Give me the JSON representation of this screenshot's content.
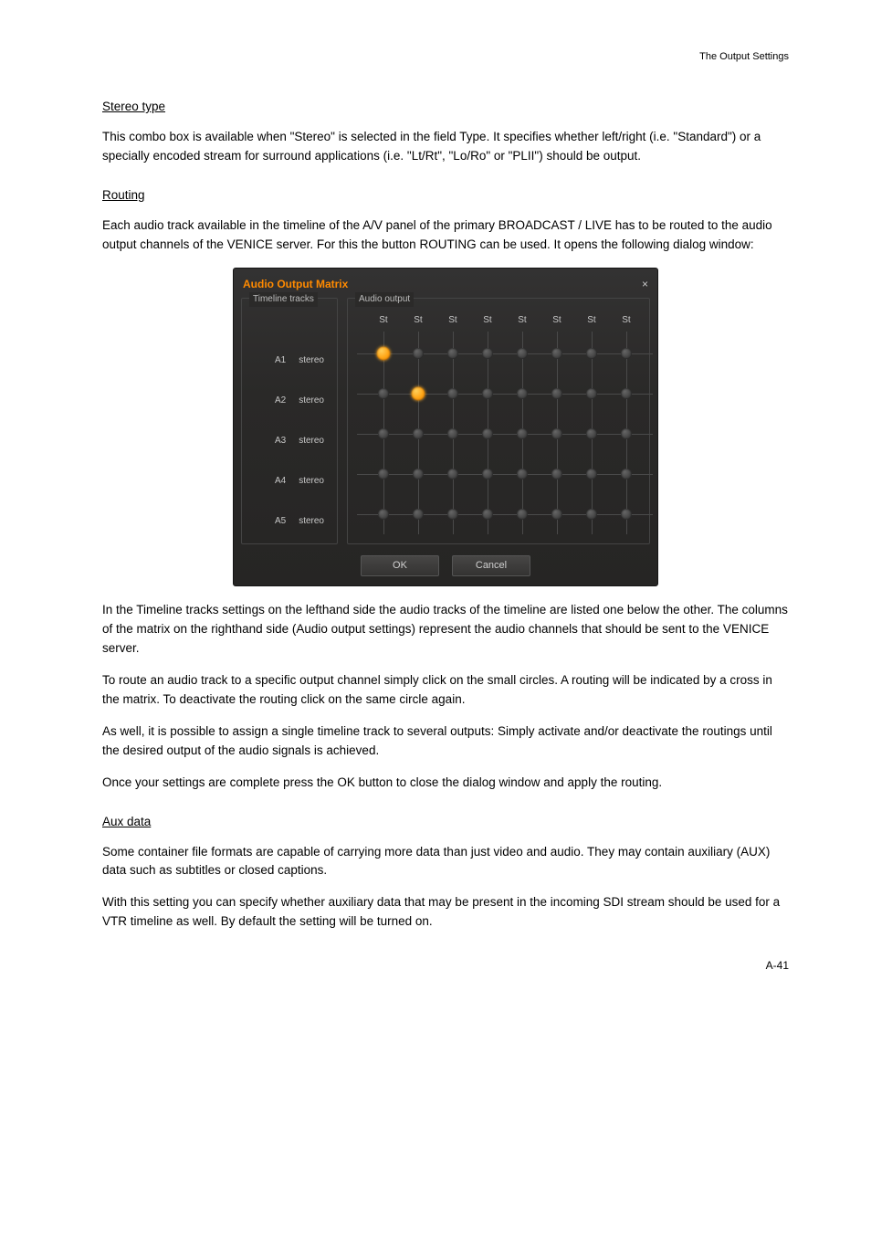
{
  "header_right": "The Output Settings",
  "section1_title": "Stereo type",
  "para1": "This combo box is available when \"Stereo\" is selected in the field Type. It specifies whether left/right (i.e. \"Standard\") or a specially encoded stream for surround applications (i.e. \"Lt/Rt\", \"Lo/Ro\" or \"PLII\") should be output.",
  "section2_title": "Routing",
  "para2": "Each audio track available in the timeline of the A/V panel of the primary BROADCAST / LIVE has to be routed to the audio output channels of the VENICE server. For this the button ROUTING can be used. It opens the following dialog window:",
  "dialog": {
    "title": "Audio Output Matrix",
    "close_glyph": "×",
    "legend_tracks": "Timeline tracks",
    "legend_output": "Audio output",
    "output_cols": [
      "St",
      "St",
      "St",
      "St",
      "St",
      "St",
      "St",
      "St"
    ],
    "tracks": [
      {
        "id": "A1",
        "type": "stereo"
      },
      {
        "id": "A2",
        "type": "stereo"
      },
      {
        "id": "A3",
        "type": "stereo"
      },
      {
        "id": "A4",
        "type": "stereo"
      },
      {
        "id": "A5",
        "type": "stereo"
      }
    ],
    "active_nodes": [
      [
        0,
        0
      ],
      [
        1,
        1
      ]
    ],
    "btn_ok": "OK",
    "btn_cancel": "Cancel"
  },
  "para3": "In the Timeline tracks settings on the lefthand side the audio tracks of the timeline are listed one below the other. The columns of the matrix on the righthand side (Audio output settings) represent the audio channels that should be sent to the VENICE server.",
  "para4": "To route an audio track to a specific output channel simply click on the small circles. A routing will be indicated by a cross in the matrix. To deactivate the routing click on the same circle again.",
  "para5": "As well, it is possible to assign a single timeline track to several outputs: Simply activate and/or deactivate the routings until the desired output of the audio signals is achieved.",
  "para6": "Once your settings are complete press the OK button to close the dialog window and apply the routing.",
  "section3_title": "Aux data",
  "para7": "Some container file formats are capable of carrying more data than just video and audio. They may contain auxiliary (AUX) data such as subtitles or closed captions.",
  "para8": "With this setting you can specify whether auxiliary data that may be present in the incoming SDI stream should be used for a VTR timeline as well. By default the setting will be turned on.",
  "page_code": "A-41"
}
